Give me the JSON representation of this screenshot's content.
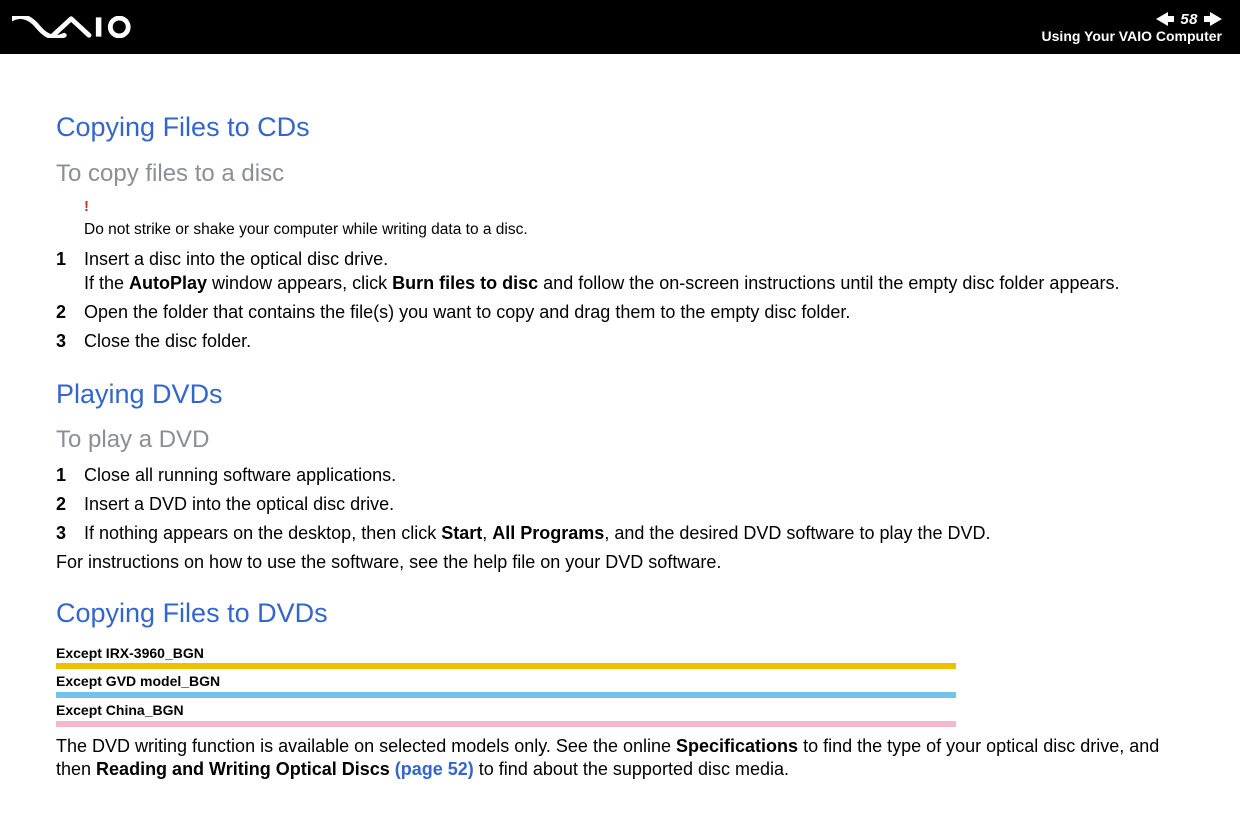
{
  "header": {
    "page_number": "58",
    "title": "Using Your VAIO Computer"
  },
  "section1": {
    "heading": "Copying Files to CDs",
    "sub": "To copy files to a disc",
    "note": "Do not strike or shake your computer while writing data to a disc.",
    "steps": {
      "s1a": "Insert a disc into the optical disc drive.",
      "s1b_pre": "If the ",
      "s1b_b1": "AutoPlay",
      "s1b_mid": " window appears, click ",
      "s1b_b2": "Burn files to disc",
      "s1b_post": " and follow the on-screen instructions until the empty disc folder appears.",
      "s2": "Open the folder that contains the file(s) you want to copy and drag them to the empty disc folder.",
      "s3": "Close the disc folder."
    }
  },
  "section2": {
    "heading": "Playing DVDs",
    "sub": "To play a DVD",
    "steps": {
      "s1": "Close all running software applications.",
      "s2": "Insert a DVD into the optical disc drive.",
      "s3_pre": "If nothing appears on the desktop, then click ",
      "s3_b1": "Start",
      "s3_m1": ", ",
      "s3_b2": "All Programs",
      "s3_post": ", and the desired DVD software to play the DVD."
    },
    "tail": "For instructions on how to use the software, see the help file on your DVD software."
  },
  "section3": {
    "heading": "Copying Files to DVDs",
    "excepts": {
      "e1": "Except IRX-3960_BGN",
      "e2": "Except GVD model_BGN",
      "e3": "Except China_BGN"
    },
    "body_pre": "The DVD writing function is available on selected models only. See the online ",
    "body_b1": "Specifications",
    "body_mid": " to find the type of your optical disc drive, and then ",
    "body_b2": "Reading and Writing Optical Discs ",
    "body_link": "(page 52)",
    "body_post": " to find about the supported disc media."
  },
  "labels": {
    "n1": "1",
    "n2": "2",
    "n3": "3",
    "bang": "!"
  }
}
